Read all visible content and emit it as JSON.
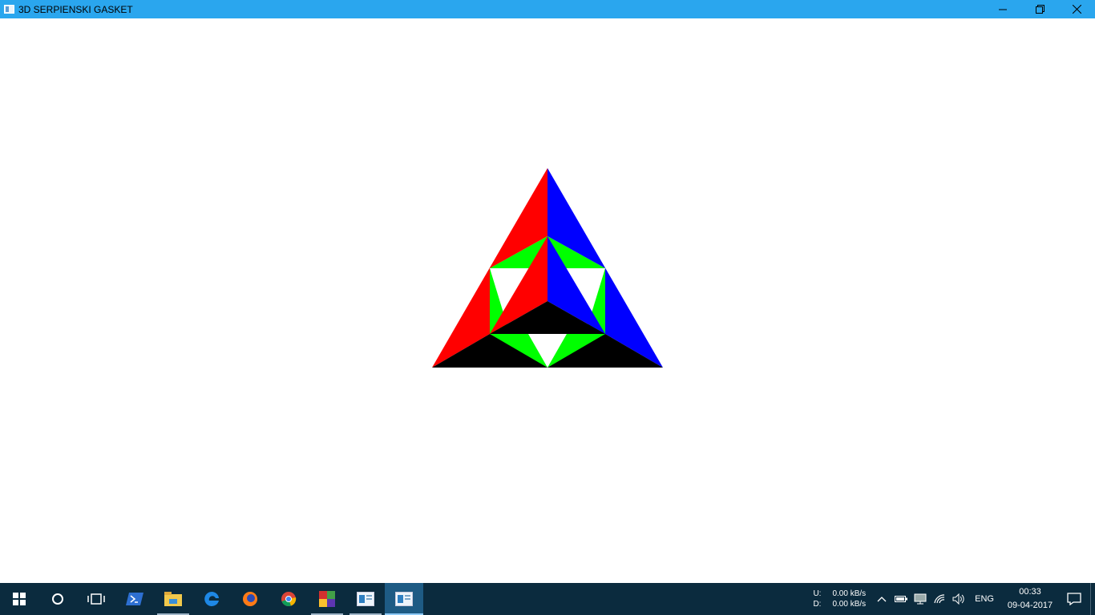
{
  "window": {
    "title": "3D SERPIENSKI GASKET",
    "icon": "app-window-icon",
    "controls": [
      "minimize-icon",
      "restore-icon",
      "close-icon"
    ]
  },
  "colors": {
    "titlebar": "#2aa6ee",
    "red_face": "#ff0000",
    "blue_face": "#0000ff",
    "green_face": "#00ff00",
    "black_face": "#000000",
    "background": "#ffffff",
    "taskbar": "#0b2b3e"
  },
  "taskbar": {
    "items": [
      {
        "name": "start-button",
        "icon": "windows-logo-icon"
      },
      {
        "name": "cortana-button",
        "icon": "circle-search-icon"
      },
      {
        "name": "task-view-button",
        "icon": "task-view-icon"
      },
      {
        "name": "powershell-button",
        "icon": "powershell-icon"
      },
      {
        "name": "file-explorer-button",
        "icon": "folder-icon"
      },
      {
        "name": "edge-button",
        "icon": "edge-icon"
      },
      {
        "name": "firefox-button",
        "icon": "firefox-icon"
      },
      {
        "name": "chrome-button",
        "icon": "chrome-icon"
      },
      {
        "name": "winrar-button",
        "icon": "colorful-blocks-icon"
      },
      {
        "name": "window-app-button",
        "icon": "app-window-icon"
      },
      {
        "name": "gasket-app-button",
        "icon": "app-window-icon"
      }
    ],
    "tray": {
      "upload_label": "U:",
      "download_label": "D:",
      "upload_speed": "0.00 kB/s",
      "download_speed": "0.00 kB/s",
      "language": "ENG",
      "time": "00:33",
      "date": "09-04-2017"
    }
  }
}
